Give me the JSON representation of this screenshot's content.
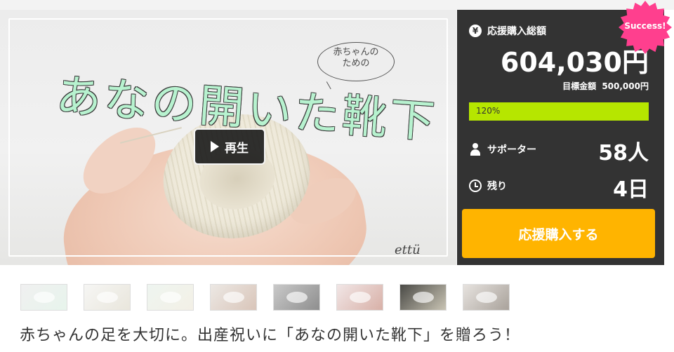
{
  "hero": {
    "title_art": "あなの開いた靴下",
    "bubble_text": "赤ちゃんの\nための",
    "logo": "ettü",
    "play_label": "再生"
  },
  "panel": {
    "total_label": "応援購入総額",
    "total_amount": "604,030円",
    "goal_label": "目標金額",
    "goal_amount": "500,000円",
    "progress_percent": 120,
    "progress_text": "120%",
    "supporters_label": "サポーター",
    "supporters_value": "58人",
    "remaining_label": "残り",
    "remaining_value": "4日",
    "buy_button_label": "応援購入する",
    "badge": "Success!"
  },
  "colors": {
    "panel_bg": "#333333",
    "progress_fill": "#b6e600",
    "buy_button": "#ffb400",
    "badge": "#ff3f8e"
  },
  "icons": [
    "yen-icon",
    "person-icon",
    "clock-icon",
    "play-icon"
  ],
  "thumbnails": [
    "thumbnail-1",
    "thumbnail-2",
    "thumbnail-3",
    "thumbnail-4",
    "thumbnail-5",
    "thumbnail-6",
    "thumbnail-7",
    "thumbnail-8"
  ],
  "project_title": "赤ちゃんの足を大切に。出産祝いに「あなの開いた靴下」を贈ろう！"
}
